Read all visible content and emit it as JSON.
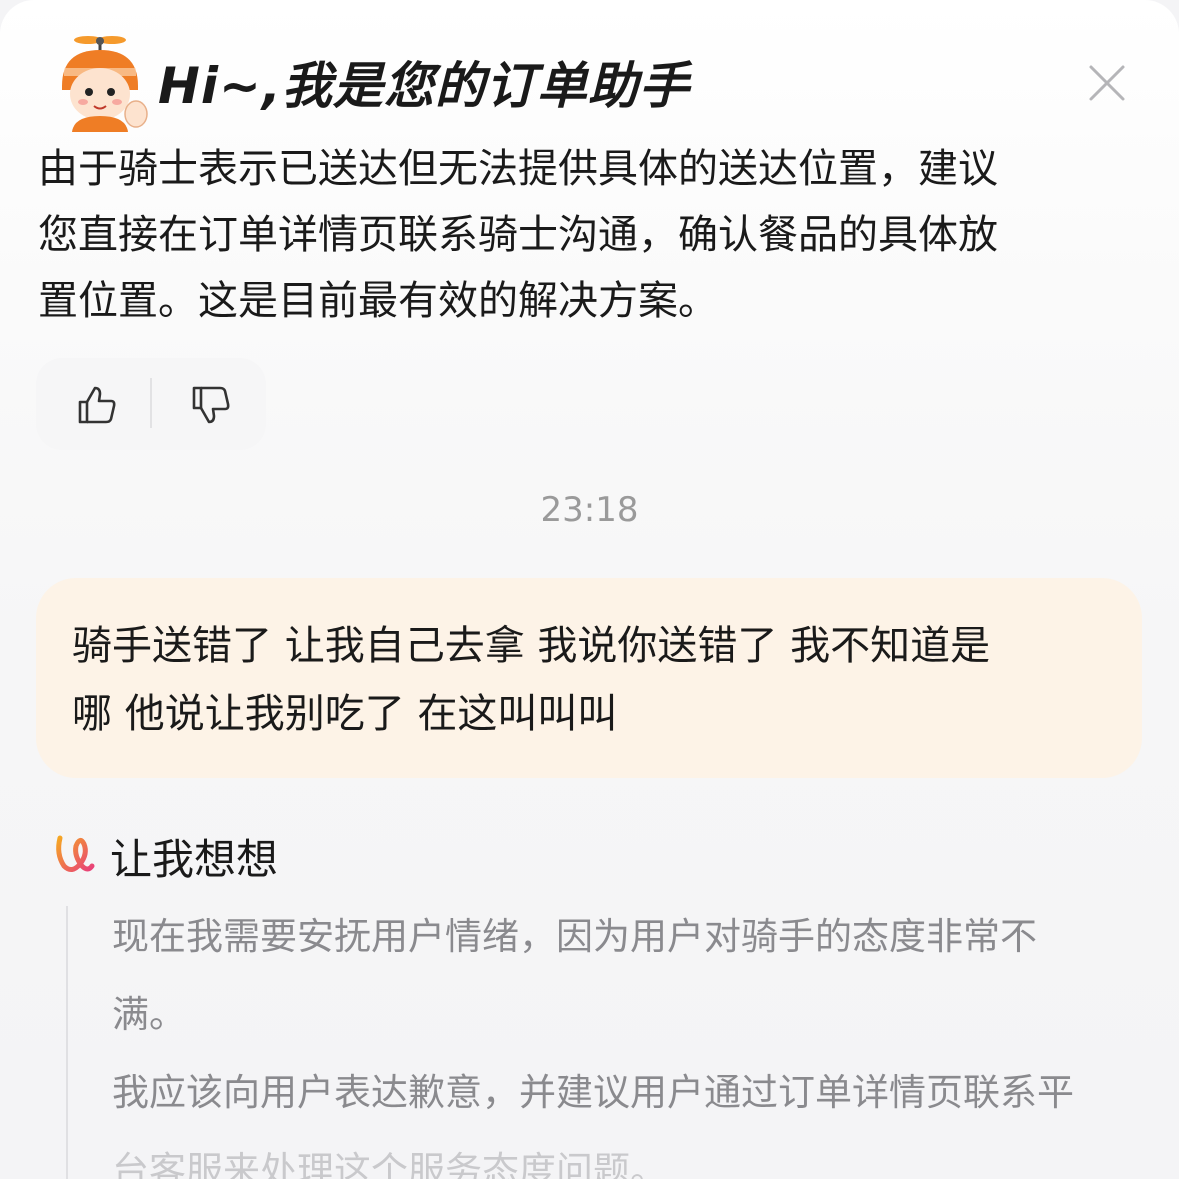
{
  "header": {
    "title": "Hi~,我是您的订单助手"
  },
  "bot_message": {
    "lines": [
      "由于骑士表示已送达但无法提供具体的送达位置，建议",
      "您直接在订单详情页联系骑士沟通，确认餐品的具体放",
      "置位置。这是目前最有效的解决方案。"
    ]
  },
  "feedback": {
    "like_icon": "thumbs-up-icon",
    "dislike_icon": "thumbs-down-icon"
  },
  "timestamp": "23:18",
  "user_message": {
    "lines": [
      "骑手送错了 让我自己去拿 我说你送错了 我不知道是",
      "哪 他说让我别吃了 在这叫叫叫"
    ]
  },
  "thinking": {
    "title": "让我想想",
    "lines": [
      "现在我需要安抚用户情绪，因为用户对骑手的态度非常不",
      "满。",
      "我应该向用户表达歉意，并建议用户通过订单详情页联系平",
      "台客服来处理这个服务态度问题。"
    ]
  },
  "colors": {
    "user_bubble": "#fdf3e7",
    "think_icon_start": "#f5a623",
    "think_icon_end": "#e8407a"
  }
}
